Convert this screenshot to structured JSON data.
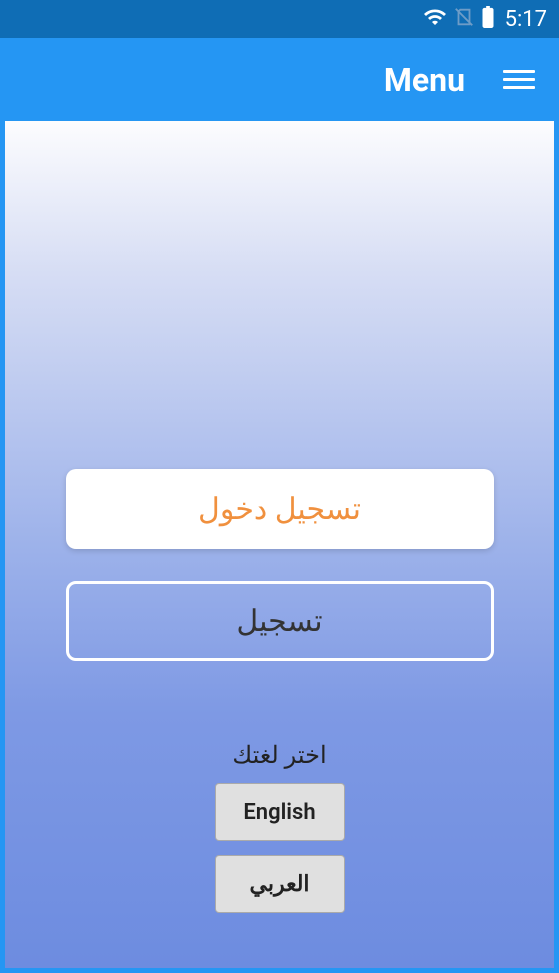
{
  "status_bar": {
    "time": "5:17"
  },
  "app_bar": {
    "title": "Menu"
  },
  "main": {
    "login_button": "تسجيل دخول",
    "register_button": "تسجيل",
    "language_label": "اختر لغتك",
    "english_button": "English",
    "arabic_button": "العربي"
  }
}
